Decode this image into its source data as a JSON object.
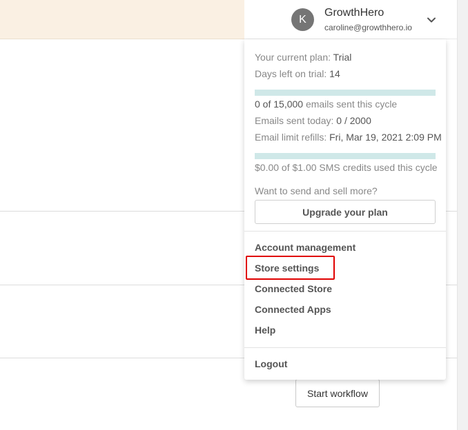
{
  "account": {
    "avatar_letter": "K",
    "name": "GrowthHero",
    "email": "caroline@growthhero.io"
  },
  "plan": {
    "current_plan_label": "Your current plan: ",
    "current_plan_value": "Trial",
    "days_left_label": "Days left on trial: ",
    "days_left_value": "14",
    "emails_cycle_count": "0 of 15,000",
    "emails_cycle_label": " emails sent this cycle",
    "emails_cycle_progress": 0,
    "emails_today_label": "Emails sent today: ",
    "emails_today_value": "0 / 2000",
    "refill_label": "Email limit refills: ",
    "refill_value": "Fri, Mar 19, 2021 2:09 PM",
    "sms_text": "$0.00 of $1.00 SMS credits used this cycle",
    "sms_progress": 0,
    "upsell_text": "Want to send and sell more?",
    "upgrade_button": "Upgrade your plan"
  },
  "menu": {
    "account_management": "Account management",
    "store_settings": "Store settings",
    "connected_store": "Connected Store",
    "connected_apps": "Connected Apps",
    "help": "Help",
    "logout": "Logout"
  },
  "main": {
    "start_workflow_button": "Start workflow"
  },
  "colors": {
    "banner": "#faf0e3",
    "progress_track": "#cfe8e8",
    "highlight": "#e00000"
  }
}
